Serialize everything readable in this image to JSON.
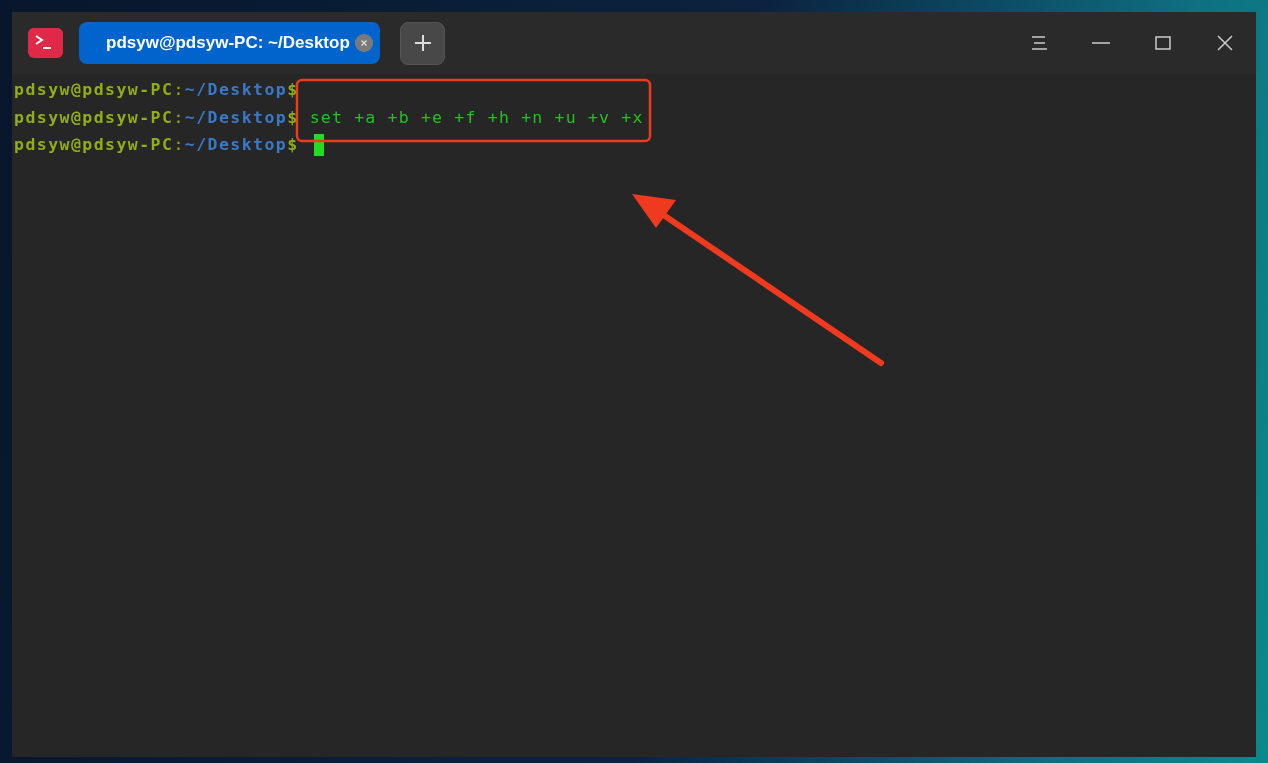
{
  "window": {
    "tabs": [
      {
        "title": "pdsyw@pdsyw-PC: ~/Desktop",
        "selected": true
      }
    ]
  },
  "terminal": {
    "lines": [
      {
        "user_host": "pdsyw@pdsyw-PC",
        "separator": ":",
        "path": "~/Desktop",
        "sign": "$",
        "cursor": false
      },
      {
        "user_host": "pdsyw@pdsyw-PC",
        "separator": ":",
        "path": "~/Desktop",
        "sign": "$",
        "command": "set +a +b +e +f +h +n +u +v +x",
        "cursor": false
      },
      {
        "user_host": "pdsyw@pdsyw-PC",
        "separator": ":",
        "path": "~/Desktop",
        "sign": "$",
        "cursor": true
      }
    ]
  },
  "annotations": [
    {
      "kind": "box"
    },
    {
      "kind": "arrow"
    }
  ]
}
